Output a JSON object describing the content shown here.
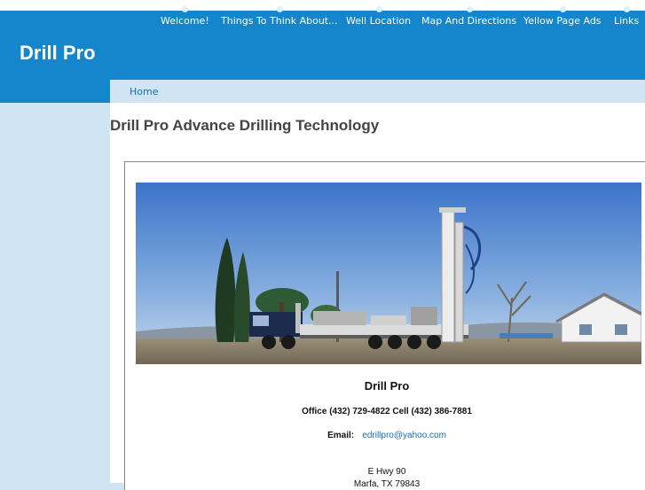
{
  "site": {
    "title": "Drill Pro"
  },
  "nav": {
    "items": [
      {
        "label": "Welcome!"
      },
      {
        "label": "Things To Think About..."
      },
      {
        "label": "Well Location"
      },
      {
        "label": "Map And Directions"
      },
      {
        "label": "Yellow Page Ads"
      },
      {
        "label": "Links"
      }
    ]
  },
  "breadcrumb": {
    "home": "Home"
  },
  "page": {
    "title": "Drill Pro Advance Drilling Technology"
  },
  "contact": {
    "company": "Drill Pro",
    "phones": "Office (432) 729-4822  Cell (432) 386-7881",
    "email_label": "Email:",
    "email": "edrillpro@yahoo.com",
    "address_line1": "E Hwy 90",
    "address_line2": "Marfa, TX 79843"
  },
  "colors": {
    "header": "#1585cc",
    "sidebar": "#cfe5f3",
    "link": "#1a6fb0"
  }
}
